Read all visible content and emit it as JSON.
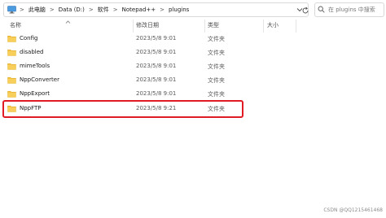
{
  "address": {
    "crumbs": [
      "此电脑",
      "Data (D:)",
      "软件",
      "Notepad++",
      "plugins"
    ],
    "separator": ">"
  },
  "search": {
    "placeholder": "在 plugins 中搜索"
  },
  "columns": {
    "name": "名称",
    "date": "修改日期",
    "type": "类型",
    "size": "大小"
  },
  "rows": [
    {
      "name": "Config",
      "date": "2023/5/8 9:01",
      "type": "文件夹"
    },
    {
      "name": "disabled",
      "date": "2023/5/8 9:01",
      "type": "文件夹"
    },
    {
      "name": "mimeTools",
      "date": "2023/5/8 9:01",
      "type": "文件夹"
    },
    {
      "name": "NppConverter",
      "date": "2023/5/8 9:01",
      "type": "文件夹"
    },
    {
      "name": "NppExport",
      "date": "2023/5/8 9:01",
      "type": "文件夹"
    },
    {
      "name": "NppFTP",
      "date": "2023/5/8 9:21",
      "type": "文件夹"
    }
  ],
  "watermark": "CSDN @QQ1215461468",
  "colors": {
    "folder": "#f5c342",
    "highlight": "#e01b24"
  },
  "icons": {
    "pc": "computer-icon",
    "folder": "folder-icon",
    "search": "search-icon",
    "dropdown": "chevron-down-icon",
    "refresh": "refresh-icon"
  }
}
